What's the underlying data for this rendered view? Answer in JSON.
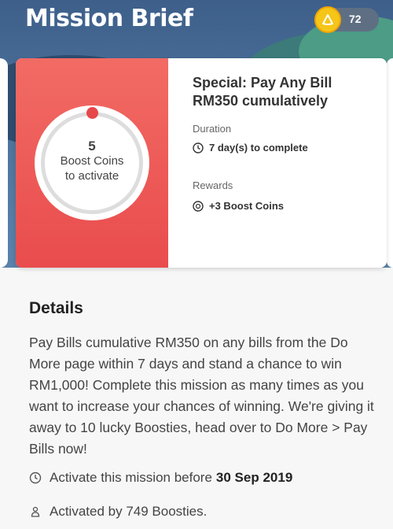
{
  "header": {
    "title": "Mission Brief",
    "coin_balance": "72",
    "coin_icon": "boost-coin-icon"
  },
  "mission": {
    "ring_count": "5",
    "ring_caption_1": "Boost Coins",
    "ring_caption_2": "to activate",
    "name": "Special: Pay Any Bill RM350 cumulatively",
    "duration_label": "Duration",
    "duration_value": "7 day(s) to complete",
    "rewards_label": "Rewards",
    "rewards_value": "+3 Boost Coins",
    "accent_color": "#e94c4d"
  },
  "details": {
    "title": "Details",
    "body": "Pay Bills cumulative RM350 on any bills from the Do More page within 7 days and stand a chance to win RM1,000! Complete this mission as many times as you want to increase your chances of winning. We're giving it away to 10 lucky Boosties, head over to Do More > Pay Bills now!",
    "activate_before_text": "Activate this mission before",
    "activate_before_date": "30 Sep 2019",
    "activated_by_text": "Activated by 749 Boosties."
  }
}
